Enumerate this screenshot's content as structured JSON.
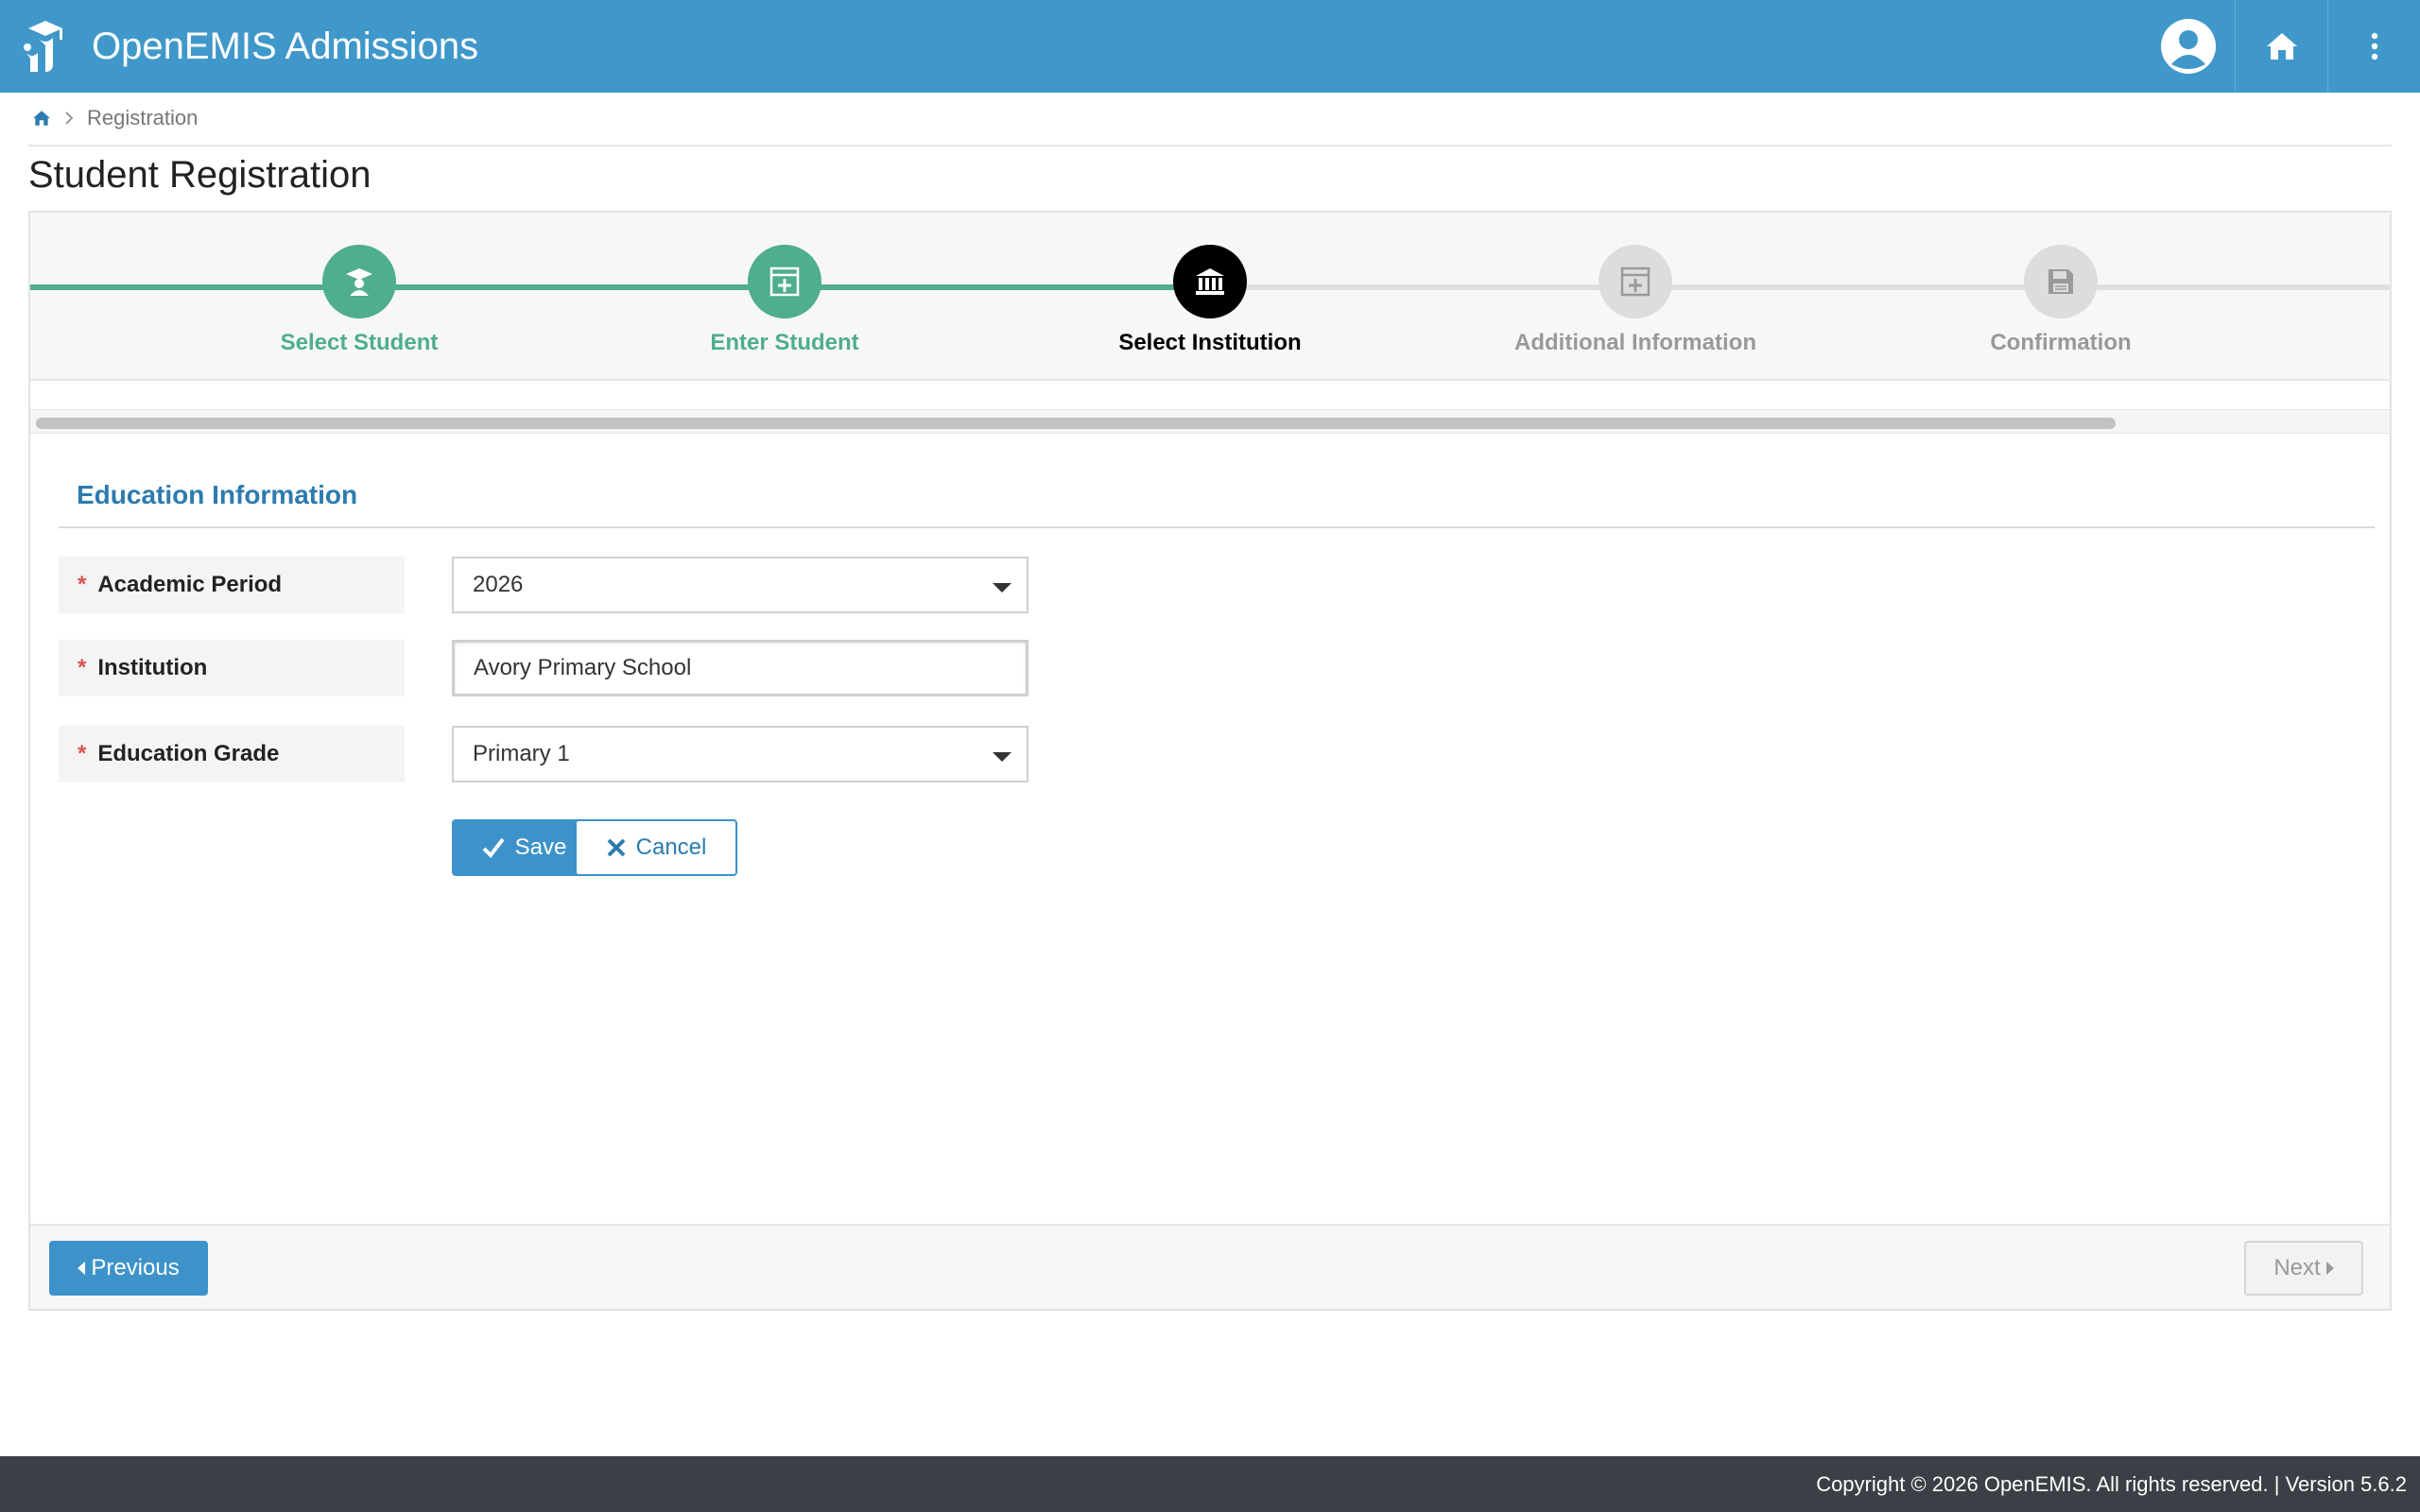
{
  "app": {
    "title": "OpenEMIS Admissions"
  },
  "header": {
    "icons": [
      "user-icon",
      "home-icon",
      "more-vertical-icon"
    ]
  },
  "breadcrumb": {
    "current": "Registration"
  },
  "page": {
    "title": "Student Registration"
  },
  "wizard": {
    "steps": [
      {
        "label": "Select Student",
        "state": "completed",
        "icon": "graduate-icon"
      },
      {
        "label": "Enter Student",
        "state": "completed",
        "icon": "form-plus-icon"
      },
      {
        "label": "Select Institution",
        "state": "active",
        "icon": "institution-icon"
      },
      {
        "label": "Additional Information",
        "state": "pending",
        "icon": "form-plus-icon"
      },
      {
        "label": "Confirmation",
        "state": "pending",
        "icon": "floppy-disk-icon"
      }
    ]
  },
  "section": {
    "title": "Education Information"
  },
  "form": {
    "required_marker": "*",
    "academic_period": {
      "label": "Academic Period",
      "value": "2026"
    },
    "institution": {
      "label": "Institution",
      "value": "Avory Primary School"
    },
    "education_grade": {
      "label": "Education Grade",
      "value": "Primary 1"
    },
    "save_label": "Save",
    "cancel_label": "Cancel"
  },
  "nav": {
    "previous_label": "Previous",
    "next_label": "Next"
  },
  "footer": {
    "text": "Copyright © 2026 OpenEMIS. All rights reserved. | Version 5.6.2"
  },
  "colors": {
    "header": "#4098ca",
    "completed": "#4fae8c",
    "active": "#000000",
    "pending": "#dddddd",
    "primary_button": "#3d93c9",
    "required": "#d9534f"
  }
}
